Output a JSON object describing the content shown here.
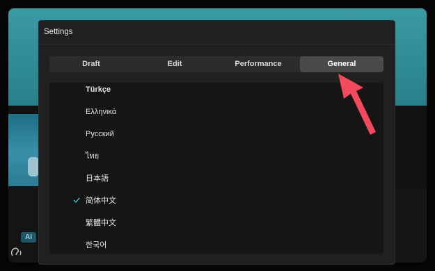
{
  "background": {
    "ai_badge": "AI"
  },
  "dialog": {
    "title": "Settings"
  },
  "tabs": [
    {
      "label": "Draft",
      "active": false
    },
    {
      "label": "Edit",
      "active": false
    },
    {
      "label": "Performance",
      "active": false
    },
    {
      "label": "General",
      "active": true
    }
  ],
  "languages": [
    {
      "label": "Türkçe",
      "selected": false
    },
    {
      "label": "Ελληνικά",
      "selected": false
    },
    {
      "label": "Русский",
      "selected": false
    },
    {
      "label": "ไทย",
      "selected": false
    },
    {
      "label": "日本語",
      "selected": false
    },
    {
      "label": "简体中文",
      "selected": true
    },
    {
      "label": "繁體中文",
      "selected": false
    },
    {
      "label": "한국어",
      "selected": false
    }
  ],
  "colors": {
    "accent_check": "#4fb6d6",
    "annotation_arrow": "#f24a5c",
    "teal_background": "#2e8a94"
  }
}
